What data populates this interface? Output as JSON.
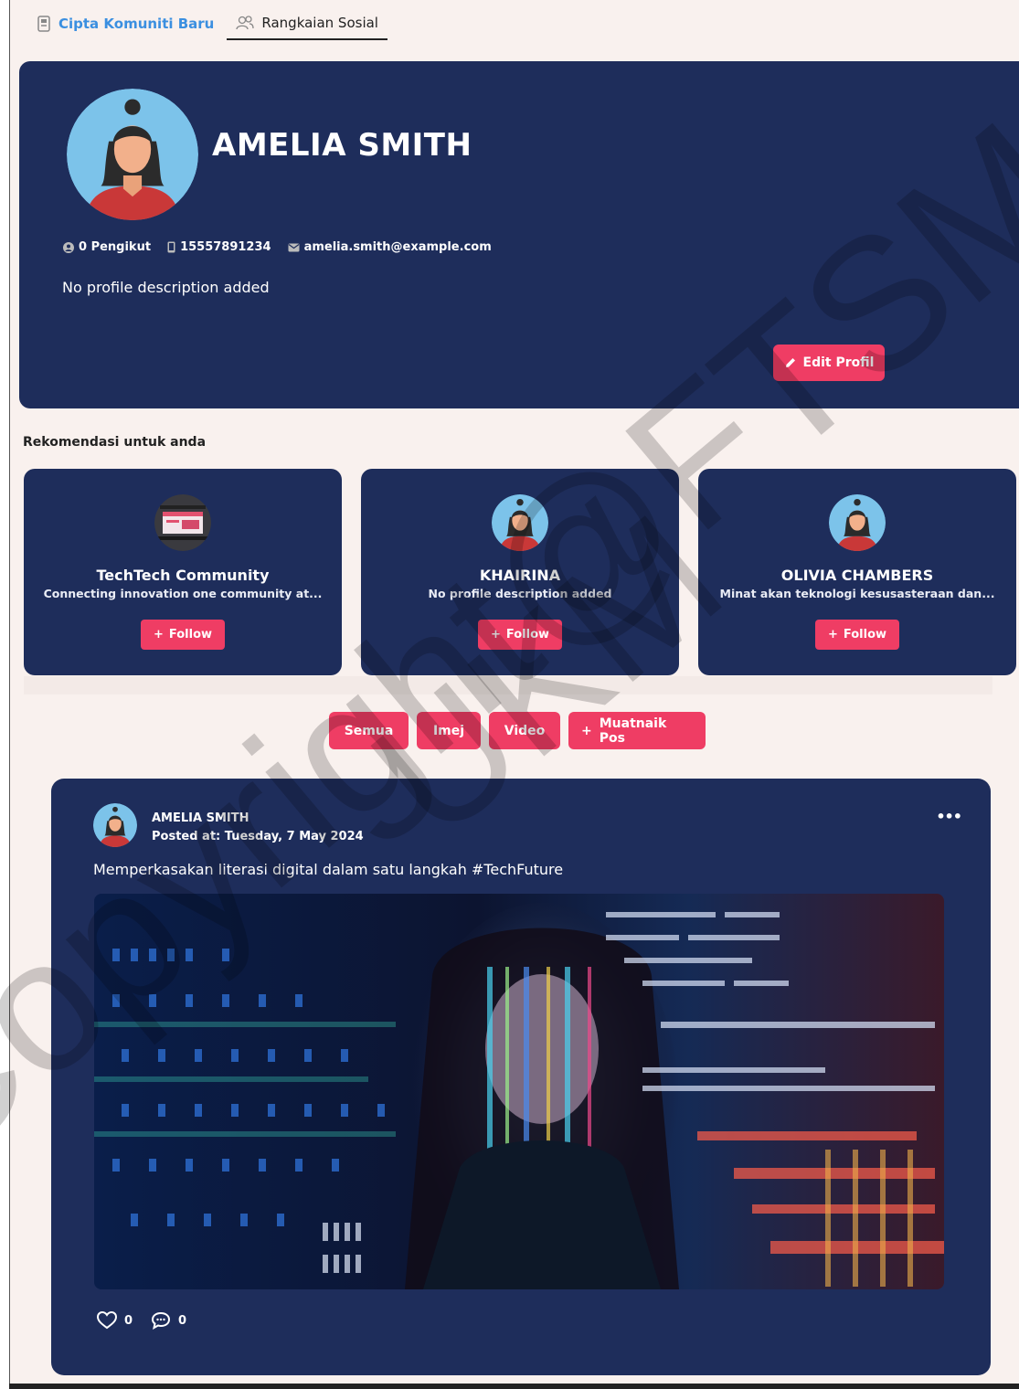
{
  "tabs": {
    "create_community": "Cipta Komuniti Baru",
    "social_network": "Rangkaian Sosial"
  },
  "profile": {
    "name": "AMELIA SMITH",
    "followers": "0 Pengikut",
    "phone": "15557891234",
    "email": "amelia.smith@example.com",
    "description": "No profile description added",
    "edit_label": "Edit Profil"
  },
  "recommendations": {
    "title": "Rekomendasi untuk anda",
    "items": [
      {
        "name": "TechTech Community",
        "description": "Connecting innovation one community at...",
        "follow_label": "Follow"
      },
      {
        "name": "KHAIRINA",
        "description": "No profile description added",
        "follow_label": "Follow"
      },
      {
        "name": "OLIVIA CHAMBERS",
        "description": "Minat akan teknologi kesusasteraan dan...",
        "follow_label": "Follow"
      }
    ]
  },
  "filters": {
    "all": "Semua",
    "image": "Imej",
    "video": "Video",
    "upload": "Muatnaik Pos"
  },
  "post": {
    "author": "AMELIA SMITH",
    "posted_at": "Posted at: Tuesday, 7 May 2024",
    "text": "Memperkasakan literasi digital dalam satu langkah #TechFuture",
    "likes": "0",
    "comments": "0",
    "more": "•••"
  },
  "watermark": {
    "line1": "Copyright@FTSM",
    "line2": "UKM"
  },
  "colors": {
    "card_bg": "#1e2d5b",
    "accent": "#ef3d64",
    "page_bg": "#f9f1ee",
    "link": "#3b8fe0"
  }
}
